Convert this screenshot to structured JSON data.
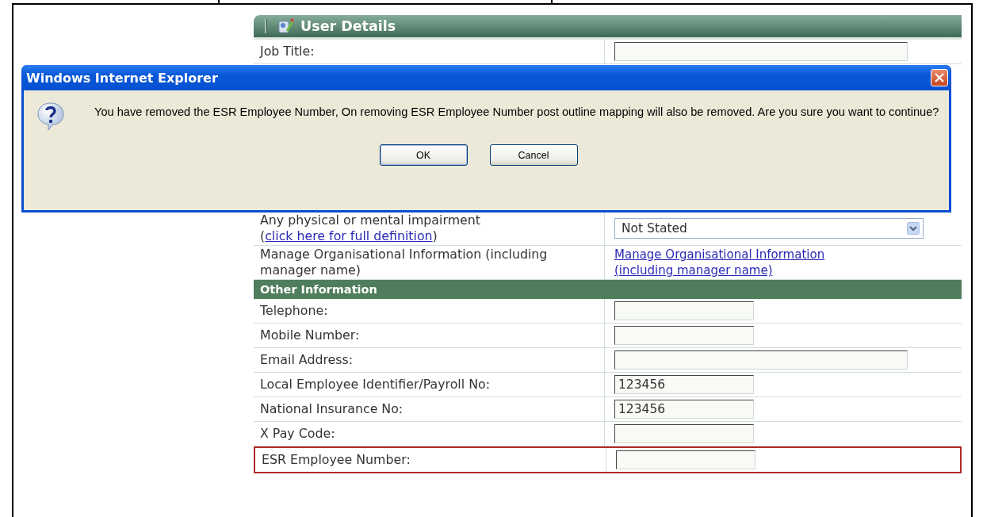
{
  "panel": {
    "title": "User Details",
    "rows": [
      {
        "kind": "long-field",
        "label": "Job Title:",
        "highlighted": false
      },
      {
        "kind": "select",
        "label_before": "Any physical or mental impairment (",
        "link": "click here for full definition",
        "label_after": ")",
        "value": "Not Stated",
        "highlighted": false
      },
      {
        "kind": "link",
        "label": "Manage Organisational Information (including manager name)",
        "link": "Manage Organisational Information (including manager name)",
        "highlighted": false
      },
      {
        "kind": "section",
        "label": "Other Information",
        "highlighted": false
      },
      {
        "kind": "field",
        "label": "Telephone:",
        "highlighted": false
      },
      {
        "kind": "field",
        "label": "Mobile Number:",
        "highlighted": false
      },
      {
        "kind": "long-field",
        "label": "Email Address:",
        "highlighted": false
      },
      {
        "kind": "field",
        "label": "Local Employee Identifier/Payroll  No:",
        "value": "123456",
        "highlighted": false
      },
      {
        "kind": "field",
        "label": "National Insurance No:",
        "value": "123456",
        "highlighted": false
      },
      {
        "kind": "field",
        "label": "X Pay Code:",
        "highlighted": false
      },
      {
        "kind": "field",
        "label": "ESR Employee Number:",
        "highlighted": true
      }
    ]
  },
  "dialog": {
    "title": "Windows Internet Explorer",
    "message": "You have removed the ESR Employee Number, On removing ESR Employee Number post outline mapping will also be removed. Are you sure you want to continue?",
    "buttons": [
      {
        "label": "OK",
        "focused": true
      },
      {
        "label": "Cancel",
        "focused": false
      }
    ]
  }
}
